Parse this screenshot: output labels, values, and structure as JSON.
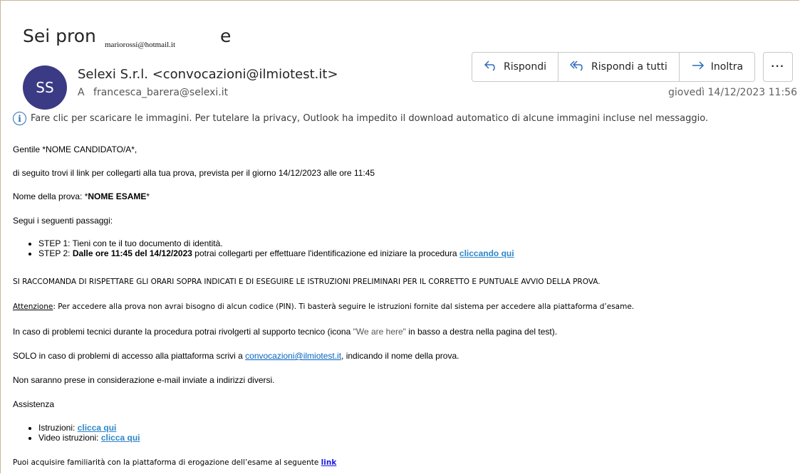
{
  "header": {
    "subject_start": "Sei pron",
    "subject_end": "e",
    "overlay_email": "mariorossi@hotmail.it",
    "avatar_initials": "SS",
    "sender": "Selexi S.r.l. <convocazioni@ilmiotest.it>",
    "to_label": "A",
    "recipient": "francesca_barera@selexi.it",
    "date": "giovedì 14/12/2023 11:56"
  },
  "actions": {
    "reply": "Rispondi",
    "reply_all": "Rispondi a tutti",
    "forward": "Inoltra",
    "more": "···"
  },
  "infobar": {
    "text": "Fare clic per scaricare le immagini. Per tutelare la privacy, Outlook ha impedito il download automatico di alcune immagini incluse nel messaggio."
  },
  "body": {
    "greeting": "Gentile *NOME CANDIDATO/A*,",
    "intro": "di seguito trovi il link per collegarti alla tua prova, prevista per il giorno 14/12/2023 alle ore 11:45",
    "exam_label": "Nome della prova: *",
    "exam_name": "NOME ESAME",
    "exam_end": "*",
    "steps_intro": "Segui i seguenti passaggi:",
    "step1": "STEP 1: Tieni con te il tuo documento di identità.",
    "step2_a": "STEP 2: ",
    "step2_bold": "Dalle ore 11:45 del 14/12/2023",
    "step2_b": " potrai collegarti per effettuare l'identificazione ed iniziare la procedura ",
    "step2_link": "cliccando qui",
    "recommend": "SI RACCOMANDA DI RISPETTARE GLI ORARI SOPRA INDICATI E DI ESEGUIRE LE ISTRUZIONI PRELIMINARI PER IL CORRETTO E PUNTUALE AVVIO DELLA PROVA.",
    "attention_label": "Attenzione",
    "attention_text": ": Per accedere alla prova non avrai bisogno di alcun codice (PIN). Ti basterà seguire le istruzioni fornite dal sistema per accedere alla piattaforma d’esame.",
    "support_a": "In caso di problemi tecnici durante la procedura potrai rivolgerti al supporto tecnico (icona ",
    "support_we": "\"We are here\"",
    "support_b": " in basso a destra nella pagina del test).",
    "solo_a": "SOLO in caso di problemi di accesso alla piattaforma scrivi a ",
    "solo_mail": "convocazioni@ilmiotest.it",
    "solo_b": ", indicando il nome della prova.",
    "no_email": "Non saranno prese in considerazione e-mail inviate a indirizzi diversi.",
    "assistance": "Assistenza",
    "instr_label": "Istruzioni: ",
    "instr_link": "clicca qui",
    "video_label": "Video istruzioni: ",
    "video_link": "clicca qui",
    "familiar": "Puoi acquisire familiarità con la piattaforma di erogazione dell’esame al seguente ",
    "familiar_link": "link"
  }
}
